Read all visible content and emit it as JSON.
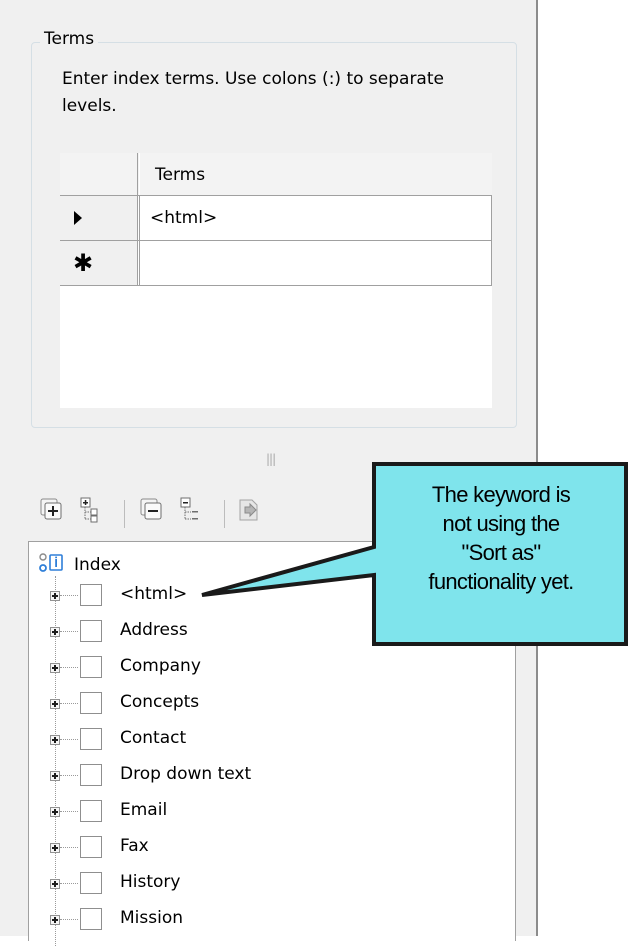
{
  "terms_group": {
    "title": "Terms",
    "instructions": "Enter index terms. Use colons (:) to separate levels."
  },
  "grid": {
    "column_header": "Terms",
    "rows": [
      {
        "indicator": "current-row-arrow",
        "value": "<html>"
      },
      {
        "indicator": "new-row-asterisk",
        "symbol": "✱",
        "value": ""
      }
    ]
  },
  "splitter": {
    "grip": "|||"
  },
  "toolbar": {
    "buttons": [
      {
        "icon": "expand-all-icon"
      },
      {
        "icon": "expand-tree-icon"
      },
      {
        "icon": "collapse-all-icon"
      },
      {
        "icon": "collapse-tree-icon"
      },
      {
        "icon": "properties-icon"
      }
    ]
  },
  "tree": {
    "root_label": "Index",
    "items": [
      {
        "label": "<html>"
      },
      {
        "label": "Address"
      },
      {
        "label": "Company"
      },
      {
        "label": "Concepts"
      },
      {
        "label": "Contact"
      },
      {
        "label": "Drop down text"
      },
      {
        "label": "Email"
      },
      {
        "label": "Fax"
      },
      {
        "label": "History"
      },
      {
        "label": "Mission"
      }
    ]
  },
  "callout": {
    "line1": "The keyword is",
    "line2": "not using the",
    "line3": "\"Sort as\"",
    "line4": "functionality yet.",
    "fill_color": "#7fe4ec",
    "border_color": "#1a1a1a"
  }
}
